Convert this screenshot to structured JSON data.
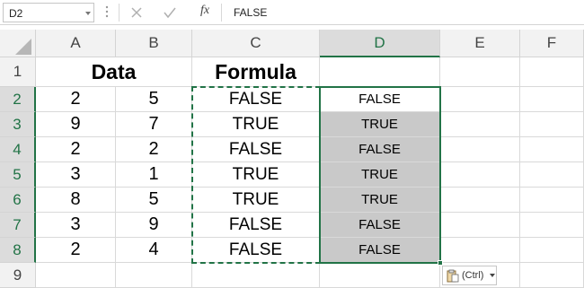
{
  "formula_bar": {
    "name_box": "D2",
    "cancel_icon": "cancel-icon",
    "enter_icon": "enter-icon",
    "fx_label": "fx",
    "formula": "FALSE"
  },
  "columns": [
    "A",
    "B",
    "C",
    "D",
    "E",
    "F"
  ],
  "rows": [
    "1",
    "2",
    "3",
    "4",
    "5",
    "6",
    "7",
    "8",
    "9"
  ],
  "sheet": {
    "headers": {
      "data": "Data",
      "formula": "Formula"
    },
    "a": [
      "2",
      "9",
      "2",
      "3",
      "8",
      "3",
      "2"
    ],
    "b": [
      "5",
      "7",
      "2",
      "1",
      "5",
      "9",
      "4"
    ],
    "c": [
      "FALSE",
      "TRUE",
      "FALSE",
      "TRUE",
      "TRUE",
      "FALSE",
      "FALSE"
    ],
    "d": [
      "FALSE",
      "TRUE",
      "FALSE",
      "TRUE",
      "TRUE",
      "FALSE",
      "FALSE"
    ]
  },
  "paste_options": {
    "label": "(Ctrl)",
    "icon": "paste-icon"
  },
  "colors": {
    "accent": "#217346",
    "selection_fill": "#c9c9c9",
    "header_bg": "#f2f2f2"
  }
}
